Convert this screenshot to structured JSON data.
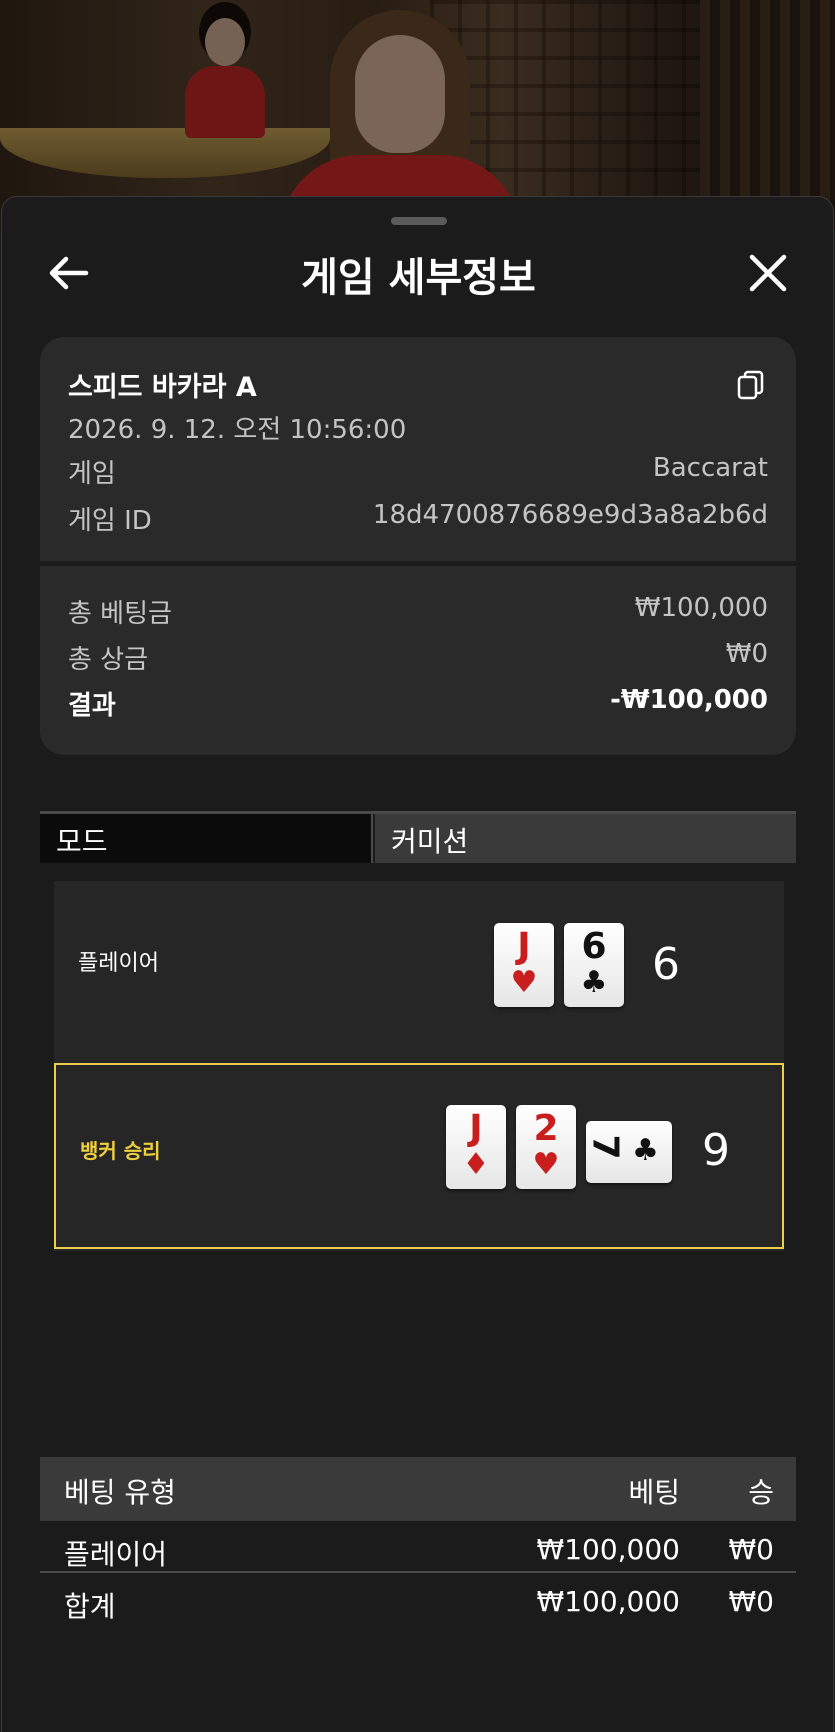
{
  "header": {
    "title": "게임 세부정보"
  },
  "summary": {
    "game_name": "스피드 바카라 A",
    "datetime": "2026. 9. 12. 오전 10:56:00",
    "game_label": "게임",
    "game_value": "Baccarat",
    "game_id_label": "게임 ID",
    "game_id_value": "18d4700876689e9d3a8a2b6d",
    "total_bet_label": "총 베팅금",
    "total_bet_value": "₩100,000",
    "total_win_label": "총 상금",
    "total_win_value": "₩0",
    "result_label": "결과",
    "result_value": "-₩100,000"
  },
  "mode": {
    "label": "모드",
    "value": "커미션"
  },
  "hands": {
    "player": {
      "label": "플레이어",
      "score": "6",
      "cards": [
        {
          "rank": "J",
          "suit": "♥",
          "color": "#c81e1e"
        },
        {
          "rank": "6",
          "suit": "♣",
          "color": "#111111"
        }
      ]
    },
    "banker": {
      "label": "뱅커 승리",
      "score": "9",
      "cards": [
        {
          "rank": "J",
          "suit": "♦",
          "color": "#c81e1e"
        },
        {
          "rank": "2",
          "suit": "♥",
          "color": "#c81e1e"
        },
        {
          "rank": "7",
          "suit": "♣",
          "color": "#111111"
        }
      ]
    }
  },
  "bets": {
    "headers": [
      "베팅 유형",
      "베팅",
      "승"
    ],
    "rows": [
      {
        "type": "플레이어",
        "bet": "₩100,000",
        "win": "₩0"
      }
    ],
    "total": {
      "type": "합계",
      "bet": "₩100,000",
      "win": "₩0"
    }
  },
  "colors": {
    "winner_highlight": "#e9cf4a",
    "sheet_bg": "#1b1b1b",
    "card_bg": "#2a2a2a"
  }
}
